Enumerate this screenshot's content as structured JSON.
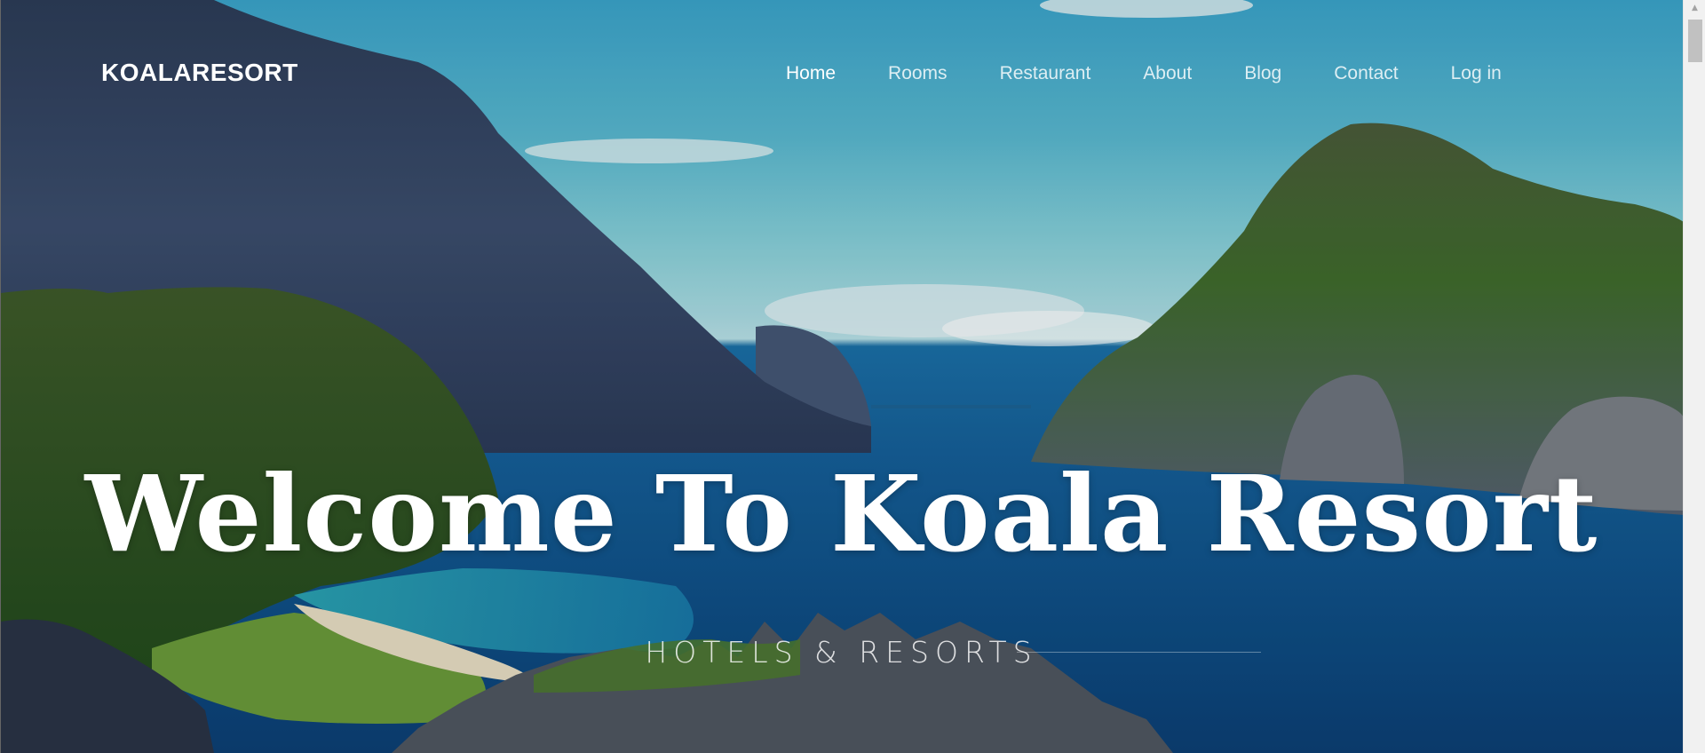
{
  "brand": {
    "name": "KOALARESORT"
  },
  "nav": {
    "items": [
      {
        "label": "Home",
        "active": true
      },
      {
        "label": "Rooms",
        "active": false
      },
      {
        "label": "Restaurant",
        "active": false
      },
      {
        "label": "About",
        "active": false
      },
      {
        "label": "Blog",
        "active": false
      },
      {
        "label": "Contact",
        "active": false
      },
      {
        "label": "Log in",
        "active": false
      }
    ]
  },
  "hero": {
    "title": "Welcome To Koala Resort",
    "subtitle": "HOTELS & RESORTS"
  },
  "colors": {
    "nav_text": "#ffffff",
    "headline": "#ffffff",
    "sea": "#155f98",
    "sky": "#58b7cf"
  },
  "icons": {
    "scroll_up": "chevron-up-icon"
  }
}
